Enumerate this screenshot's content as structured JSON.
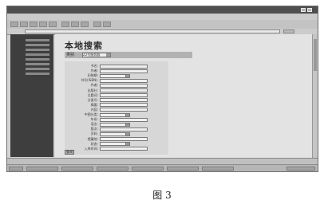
{
  "page": {
    "title": "本地搜索",
    "category_label": "类别",
    "category_value": "Z2号服务器"
  },
  "form": {
    "rows": [
      {
        "label": "书名:",
        "kind": "text"
      },
      {
        "label": "作者:",
        "kind": "text"
      },
      {
        "label": "印刷期:",
        "kind": "select"
      },
      {
        "label": "书号(ISBN):",
        "kind": "text"
      },
      {
        "label": "作者:",
        "kind": "text"
      },
      {
        "label": "出版社:",
        "kind": "text"
      },
      {
        "label": "主题词:",
        "kind": "text"
      },
      {
        "label": "分类号:",
        "kind": "text"
      },
      {
        "label": "摘要:",
        "kind": "text"
      },
      {
        "label": "内容:",
        "kind": "text"
      },
      {
        "label": "中图分类:",
        "kind": "select"
      },
      {
        "label": "年份:",
        "kind": "text"
      },
      {
        "label": "语言:",
        "kind": "select"
      },
      {
        "label": "版次:",
        "kind": "text"
      },
      {
        "label": "页码:",
        "kind": "select"
      },
      {
        "label": "馆藏地:",
        "kind": "text"
      },
      {
        "label": "状态:",
        "kind": "select"
      },
      {
        "label": "入库时间:",
        "kind": "text"
      }
    ],
    "submit_label": "查询"
  },
  "caption": "图 3"
}
